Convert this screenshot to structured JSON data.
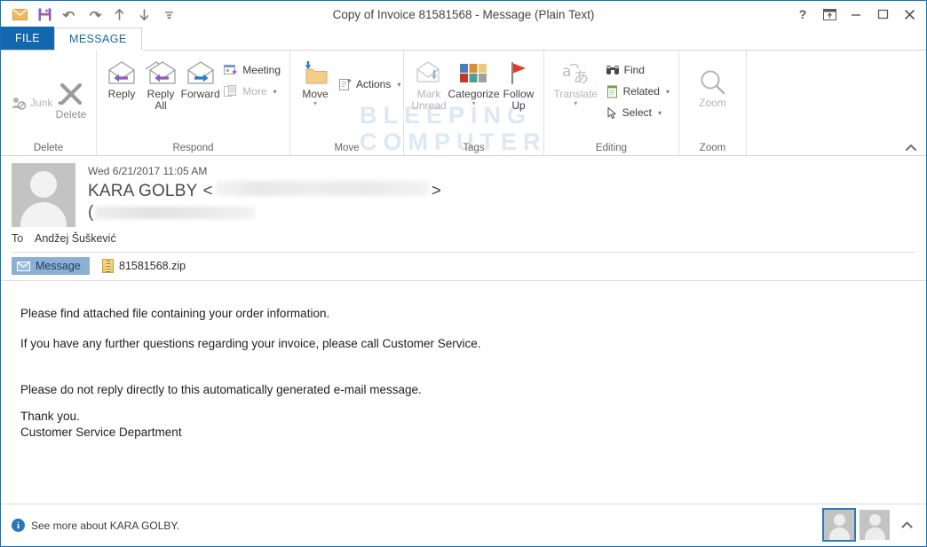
{
  "window": {
    "title": "Copy of Invoice 81581568 - Message (Plain Text)",
    "accent_color": "#1073b5"
  },
  "quick_access": {
    "items": [
      {
        "name": "mail-icon",
        "label": "Mail"
      },
      {
        "name": "save-icon",
        "label": "Save"
      },
      {
        "name": "undo-icon",
        "label": "Undo"
      },
      {
        "name": "redo-icon",
        "label": "Redo"
      },
      {
        "name": "previous-item-icon",
        "label": "Previous Item"
      },
      {
        "name": "next-item-icon",
        "label": "Next Item"
      },
      {
        "name": "customize-quick-access-toolbar-icon",
        "label": "Customize Quick Access Toolbar"
      }
    ]
  },
  "window_controls": {
    "help": "?",
    "ribbon_display_options": "Ribbon Display Options",
    "minimize": "Minimize",
    "maximize": "Maximize",
    "close": "Close"
  },
  "tabs": [
    {
      "label": "FILE",
      "active": false
    },
    {
      "label": "MESSAGE",
      "active": true
    }
  ],
  "ribbon": {
    "watermark_line1": "BLEEPING",
    "watermark_line2": "COMPUTER",
    "collapse_label": "Collapse the Ribbon",
    "groups": [
      {
        "label": "Delete",
        "buttons": [
          {
            "label": "Junk",
            "caret": true,
            "disabled": true
          },
          {
            "label": "Delete",
            "caret": false,
            "disabled": false
          }
        ]
      },
      {
        "label": "Respond",
        "buttons": [
          {
            "label": "Reply"
          },
          {
            "label": "Reply",
            "label2": "All"
          },
          {
            "label": "Forward"
          }
        ],
        "small_buttons": [
          {
            "label": "Meeting",
            "caret": false,
            "disabled": false
          },
          {
            "label": "More",
            "caret": true,
            "disabled": true
          }
        ]
      },
      {
        "label": "Move",
        "buttons": [
          {
            "label": "Move",
            "caret": true
          }
        ],
        "small_buttons": [
          {
            "label": "Actions",
            "caret": true,
            "disabled": false
          }
        ]
      },
      {
        "label": "Tags",
        "has_launcher": true,
        "buttons": [
          {
            "label": "Mark",
            "label2": "Unread",
            "disabled": true
          },
          {
            "label": "Categorize",
            "caret": true
          },
          {
            "label": "Follow",
            "label2": "Up",
            "caret": true
          }
        ]
      },
      {
        "label": "Editing",
        "buttons": [
          {
            "label": "Translate",
            "caret": true,
            "disabled": true
          }
        ],
        "small_buttons": [
          {
            "label": "Find",
            "caret": false
          },
          {
            "label": "Related",
            "caret": true
          },
          {
            "label": "Select",
            "caret": true
          }
        ]
      },
      {
        "label": "Zoom",
        "buttons": [
          {
            "label": "Zoom",
            "disabled": true
          }
        ]
      }
    ]
  },
  "message": {
    "date": "Wed 6/21/2017 11:05 AM",
    "sender_name": "KARA GOLBY",
    "sender_email_redacted": true,
    "email_open_bracket": "<",
    "email_close_bracket": ">",
    "second_line_prefix": "(",
    "to_label": "To",
    "to_value": "Andžej Šuškević",
    "message_tab_label": "Message",
    "attachment": {
      "filename": "81581568.zip",
      "icon": "zip-file-icon"
    },
    "body": {
      "line1": "Please find attached file containing your order information.",
      "line2": "If you have any further questions regarding your invoice, please call Customer Service.",
      "line3": "Please do not reply directly to this automatically generated e-mail message.",
      "line4": "Thank you.",
      "line5": "Customer Service Department"
    }
  },
  "status_bar": {
    "see_more_text": "See more about KARA GOLBY.",
    "info_icon": "i",
    "people_pane_expand": "Expand People Pane"
  }
}
